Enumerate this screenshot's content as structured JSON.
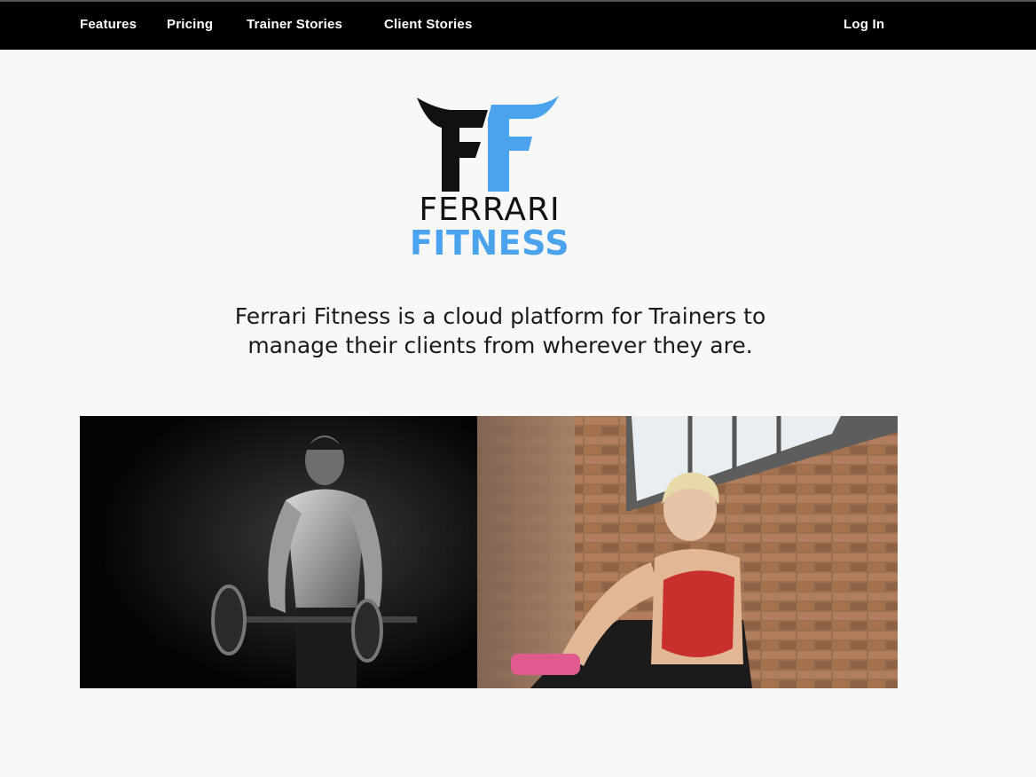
{
  "nav": {
    "features": "Features",
    "pricing": "Pricing",
    "trainer_stories": "Trainer Stories",
    "client_stories": "Client Stories",
    "login": "Log In"
  },
  "logo": {
    "word1": "FERRARI",
    "word2": "FITNESS",
    "colors": {
      "dark": "#111111",
      "accent": "#4aa3ec"
    }
  },
  "hero": {
    "tagline_line1": "Ferrari Fitness is a cloud platform for Trainers to",
    "tagline_line2": "manage their clients from wherever they are."
  },
  "images": {
    "left": "trainer-weightlifting-photo",
    "right": "woman-with-dumbbell-photo"
  }
}
